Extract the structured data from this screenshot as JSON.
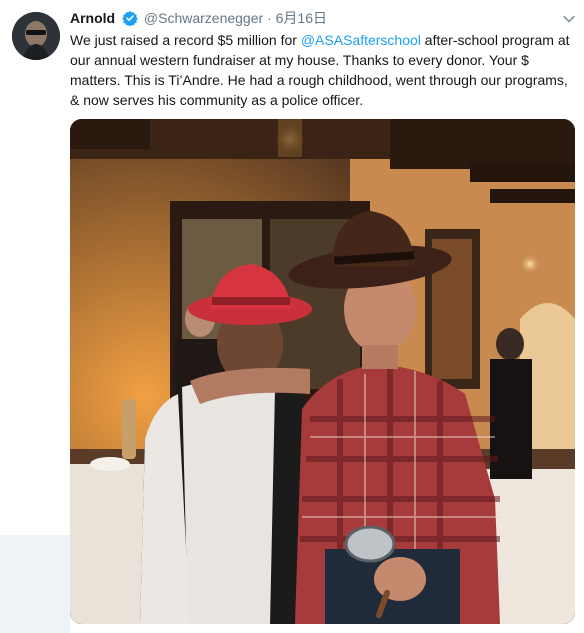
{
  "tweet": {
    "display_name": "Arnold",
    "handle": "@Schwarzenegger",
    "separator": "·",
    "date": "6月16日",
    "text_before": "We just raised a record $5 million for ",
    "mention": "@ASASafterschool",
    "text_after": " after-school program at our annual western fundraiser at my house. Thanks to every donor. Your $ matters. This is Ti’Andre. He had a rough childhood, went through our programs, & now serves his community as a police officer."
  },
  "icons": {
    "verified": "verified-badge-icon",
    "more": "chevron-down-icon"
  },
  "colors": {
    "link": "#1da1f2",
    "verified": "#1da1f2",
    "meta_text": "#657786",
    "body_text": "#14171a"
  }
}
